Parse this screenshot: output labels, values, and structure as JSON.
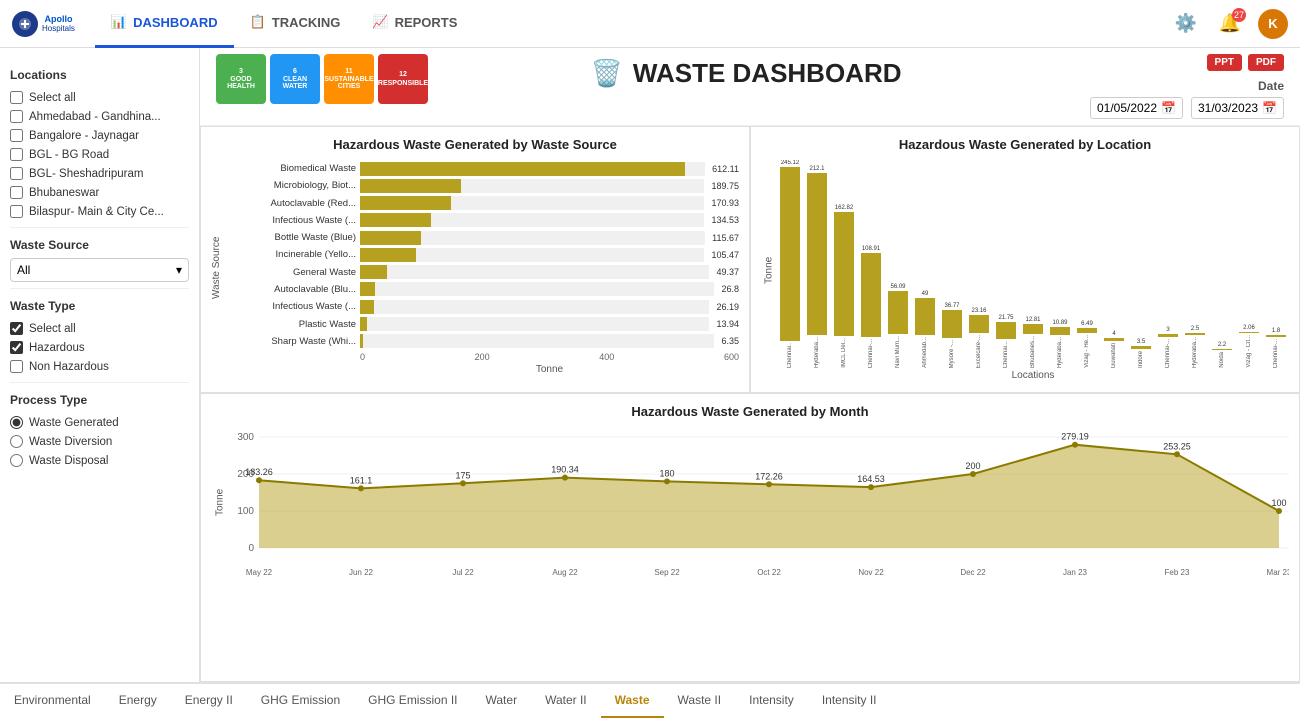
{
  "nav": {
    "logo_text": "Apollo\nHospitals",
    "items": [
      {
        "label": "DASHBOARD",
        "icon": "📊",
        "active": true
      },
      {
        "label": "TRACKING",
        "icon": "📋",
        "active": false
      },
      {
        "label": "REPORTS",
        "icon": "📈",
        "active": false
      }
    ],
    "avatar_label": "K",
    "notification_count": "27"
  },
  "header": {
    "title": "WASTE DASHBOARD",
    "date_label": "Date",
    "date_from": "01/05/2022",
    "date_to": "31/03/2023",
    "export_ppt": "PPT",
    "export_pdf": "PDF"
  },
  "sdg": [
    {
      "num": "3",
      "label": "GOOD HEALTH\nAND WELL-BEING",
      "class": "sdg-3"
    },
    {
      "num": "6",
      "label": "CLEAN WATER\nAND SANITATION",
      "class": "sdg-6"
    },
    {
      "num": "11",
      "label": "SUSTAINABLE\nCITIES",
      "class": "sdg-11"
    },
    {
      "num": "12",
      "label": "RESPONSIBLE\nCONSUMPTION",
      "class": "sdg-12"
    }
  ],
  "sidebar": {
    "locations_title": "Locations",
    "location_items": [
      {
        "label": "Select all",
        "checked": false
      },
      {
        "label": "Ahmedabad - Gandhina...",
        "checked": false
      },
      {
        "label": "Bangalore - Jaynagar",
        "checked": false
      },
      {
        "label": "BGL - BG Road",
        "checked": false
      },
      {
        "label": "BGL- Sheshadripuram",
        "checked": false
      },
      {
        "label": "Bhubaneswar",
        "checked": false
      },
      {
        "label": "Bilaspur- Main & City Ce...",
        "checked": false
      }
    ],
    "waste_source_title": "Waste Source",
    "waste_source_value": "All",
    "waste_type_title": "Waste Type",
    "waste_type_items": [
      {
        "label": "Select all",
        "checked": true
      },
      {
        "label": "Hazardous",
        "checked": true
      },
      {
        "label": "Non Hazardous",
        "checked": false
      }
    ],
    "process_type_title": "Process Type",
    "process_type_items": [
      {
        "label": "Waste Generated",
        "checked": true
      },
      {
        "label": "Waste Diversion",
        "checked": false
      },
      {
        "label": "Waste Disposal",
        "checked": false
      }
    ]
  },
  "chart1": {
    "title": "Hazardous Waste Generated by Waste Source",
    "y_label": "Waste Source",
    "x_label": "Tonne",
    "max": 612.11,
    "bars": [
      {
        "label": "Biomedical Waste",
        "value": 612.11
      },
      {
        "label": "Microbiology, Biot...",
        "value": 189.75
      },
      {
        "label": "Autoclavable (Red...",
        "value": 170.93
      },
      {
        "label": "Infectious Waste (...",
        "value": 134.53
      },
      {
        "label": "Bottle Waste (Blue)",
        "value": 115.67
      },
      {
        "label": "Incinerable (Yello...",
        "value": 105.47
      },
      {
        "label": "General Waste",
        "value": 49.37
      },
      {
        "label": "Autoclavable (Blu...",
        "value": 26.8
      },
      {
        "label": "Infectious Waste (...",
        "value": 26.19
      },
      {
        "label": "Plastic Waste",
        "value": 13.94
      },
      {
        "label": "Sharp Waste (Whi...",
        "value": 6.35
      }
    ],
    "x_ticks": [
      "0",
      "200",
      "400",
      "600"
    ]
  },
  "chart2": {
    "title": "Hazardous Waste Generated by Location",
    "y_label": "Tonne",
    "x_label": "Locations",
    "max": 245,
    "y_ticks": [
      "0",
      "100",
      "200"
    ],
    "bars": [
      {
        "label": "Chennai...",
        "value": 245.12
      },
      {
        "label": "Hyderaba...",
        "value": 212.1
      },
      {
        "label": "IMCL Del...",
        "value": 162.82
      },
      {
        "label": "Chennai-...",
        "value": 108.91
      },
      {
        "label": "Navi Mum...",
        "value": 56.09
      },
      {
        "label": "Ahmedab...",
        "value": 49.0
      },
      {
        "label": "Mysore -...",
        "value": 36.77
      },
      {
        "label": "Excelcare-...",
        "value": 23.16
      },
      {
        "label": "Chennai...",
        "value": 21.75
      },
      {
        "label": "Bhubanes...",
        "value": 12.81
      },
      {
        "label": "Hyderaba...",
        "value": 10.89
      },
      {
        "label": "Vizag - He...",
        "value": 6.49
      },
      {
        "label": "Guwahati",
        "value": 4.0
      },
      {
        "label": "Indore",
        "value": 3.5
      },
      {
        "label": "Chennai-...",
        "value": 3.0
      },
      {
        "label": "Hyderaba...",
        "value": 2.5
      },
      {
        "label": "Noida",
        "value": 2.2
      },
      {
        "label": "Vizag - Cit...",
        "value": 2.06
      },
      {
        "label": "Chennai-...",
        "value": 1.8
      }
    ]
  },
  "chart3": {
    "title": "Hazardous Waste Generated by Month",
    "y_label": "Tonne",
    "y_ticks": [
      "0",
      "100",
      "200",
      "300"
    ],
    "points": [
      {
        "month": "May 22",
        "value": 183.26
      },
      {
        "month": "Jun 22",
        "value": 161.1
      },
      {
        "month": "Jul 22",
        "value": 175.0
      },
      {
        "month": "Aug 22",
        "value": 190.34
      },
      {
        "month": "Sep 22",
        "value": 180.0
      },
      {
        "month": "Oct 22",
        "value": 172.26
      },
      {
        "month": "Nov 22",
        "value": 164.53
      },
      {
        "month": "Dec 22",
        "value": 200.0
      },
      {
        "month": "Jan 23",
        "value": 279.19
      },
      {
        "month": "Feb 23",
        "value": 253.25
      },
      {
        "month": "Mar 23",
        "value": 100.0
      }
    ]
  },
  "bottom_tabs": [
    {
      "label": "Environmental",
      "active": false
    },
    {
      "label": "Energy",
      "active": false
    },
    {
      "label": "Energy II",
      "active": false
    },
    {
      "label": "GHG Emission",
      "active": false
    },
    {
      "label": "GHG Emission II",
      "active": false
    },
    {
      "label": "Water",
      "active": false
    },
    {
      "label": "Water II",
      "active": false
    },
    {
      "label": "Waste",
      "active": true
    },
    {
      "label": "Waste II",
      "active": false
    },
    {
      "label": "Intensity",
      "active": false
    },
    {
      "label": "Intensity II",
      "active": false
    }
  ]
}
